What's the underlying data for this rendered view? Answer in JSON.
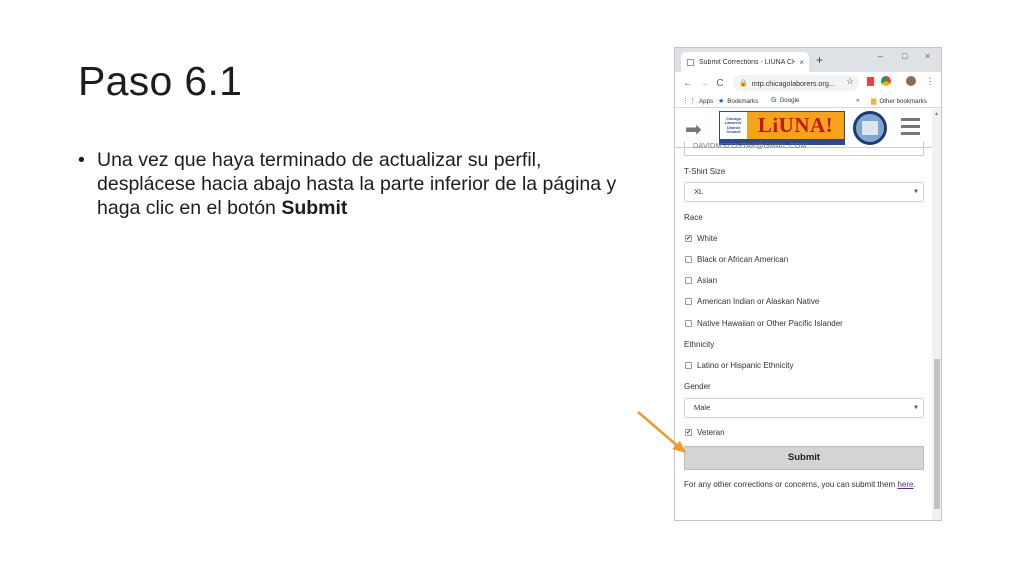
{
  "slide": {
    "title": "Paso 6.1",
    "bullet_text": "Una vez que haya terminado de actualizar su perfil, desplácese hacia abajo hasta la parte inferior de la página y haga clic en el botón ",
    "bullet_bold": "Submit"
  },
  "browser": {
    "tab_title": "Submit Corrections - LIUNA CHI",
    "tab_close": "×",
    "new_tab": "+",
    "window_controls": [
      "–",
      "□",
      "×"
    ],
    "url": "mtp.chicagolaborers.org...",
    "bookmarks": {
      "apps": "Apps",
      "bookmarks": "Bookmarks",
      "google": "Google",
      "overflow": "»",
      "other": "Other bookmarks"
    }
  },
  "site": {
    "logo_small": "Chicago Laborers' District Council",
    "logo_main": "LiUNA!"
  },
  "form": {
    "email_value": "DAVIDMSZOSTAK@GMAIL.COM",
    "tshirt_label": "T-Shirt Size",
    "tshirt_value": "XL",
    "race_label": "Race",
    "race_options": [
      {
        "label": "White",
        "checked": true
      },
      {
        "label": "Black or African American",
        "checked": false
      },
      {
        "label": "Asian",
        "checked": false
      },
      {
        "label": "American Indian or Alaskan Native",
        "checked": false
      },
      {
        "label": "Native Hawaiian or Other Pacific Islander",
        "checked": false
      }
    ],
    "ethnicity_label": "Ethnicity",
    "ethnicity_option": "Latino or Hispanic Ethnicity",
    "gender_label": "Gender",
    "gender_value": "Male",
    "veteran_label": "Veteran",
    "veteran_checked": true,
    "submit_label": "Submit",
    "footer_text": "For any other corrections or concerns, you can submit them ",
    "footer_link": "here",
    "footer_end": "."
  },
  "colors": {
    "arrow": "#ee9a2b",
    "logo_blue": "#2b4a8e",
    "logo_orange": "#f4a31b",
    "logo_red": "#c0171e"
  }
}
